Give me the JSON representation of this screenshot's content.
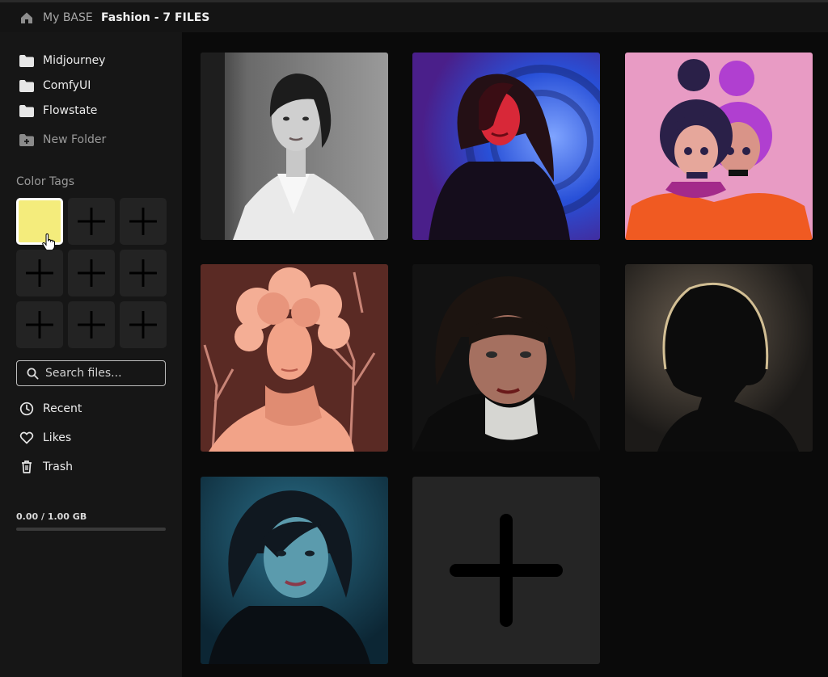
{
  "header": {
    "home_icon": "home-icon",
    "breadcrumb_root": "My BASE",
    "breadcrumb_current": "Fashion - 7 FILES"
  },
  "sidebar": {
    "folders": [
      {
        "label": "Midjourney",
        "icon": "folder-icon"
      },
      {
        "label": "ComfyUI",
        "icon": "folder-icon"
      },
      {
        "label": "Flowstate",
        "icon": "folder-icon"
      }
    ],
    "new_folder_label": "New Folder",
    "color_tags_title": "Color Tags",
    "color_tags": [
      {
        "color": "#f4ec7c",
        "state": "filled"
      },
      {
        "state": "empty"
      },
      {
        "state": "empty"
      },
      {
        "state": "empty"
      },
      {
        "state": "empty"
      },
      {
        "state": "empty"
      },
      {
        "state": "empty"
      },
      {
        "state": "empty"
      },
      {
        "state": "empty"
      }
    ],
    "search": {
      "placeholder": "Search files..."
    },
    "nav": [
      {
        "label": "Recent",
        "icon": "clock-icon"
      },
      {
        "label": "Likes",
        "icon": "heart-icon"
      },
      {
        "label": "Trash",
        "icon": "trash-icon"
      }
    ],
    "storage": {
      "text": "0.00 / 1.00 GB",
      "used_fraction": 0.0
    }
  },
  "gallery": {
    "thumbnails": [
      {
        "subject": "black-and-white portrait, white coat"
      },
      {
        "subject": "portrait in red and blue light"
      },
      {
        "subject": "two illustrated girls, pink background"
      },
      {
        "subject": "peach sculpted floral headdress portrait"
      },
      {
        "subject": "close-up portrait with bangs, white turtleneck"
      },
      {
        "subject": "backlit silhouette"
      },
      {
        "subject": "portrait in teal light"
      }
    ],
    "add_tile_icon": "plus-icon"
  },
  "colors": {
    "background": "#0a0a0a",
    "sidebar": "#161616",
    "accent_tag": "#f4ec7c"
  }
}
